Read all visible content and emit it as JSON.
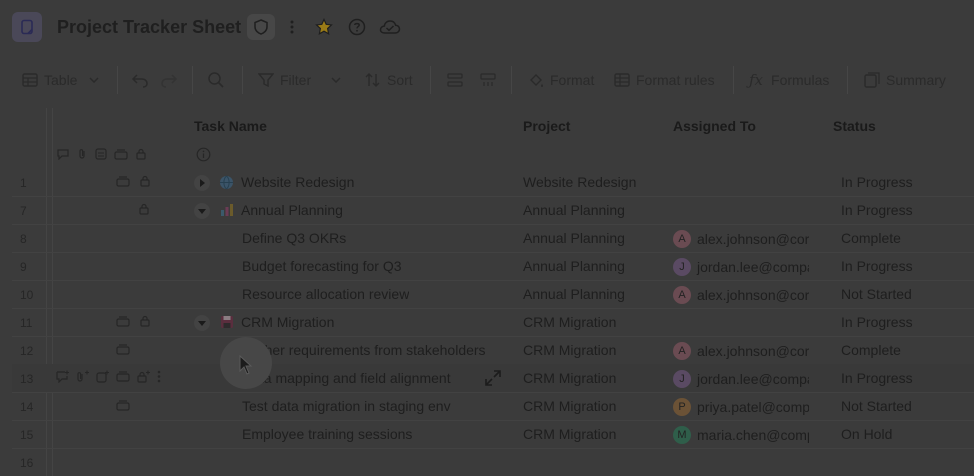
{
  "app": {
    "title": "Project Tracker Sheet",
    "icons": [
      "doc-icon",
      "shield-icon",
      "more-vertical-icon",
      "star-icon",
      "help-icon",
      "cloud-check-icon"
    ],
    "accent": "#c9a227"
  },
  "toolbar": {
    "view_label": "Table",
    "filter_label": "Filter",
    "sort_label": "Sort",
    "format_label": "Format",
    "format_rules_label": "Format rules",
    "formulas_label": "Formulas",
    "summary_label": "Summary"
  },
  "columns": {
    "task": "Task Name",
    "project": "Project",
    "assigned": "Assigned To",
    "status": "Status"
  },
  "rows": [
    {
      "num": "1",
      "task": "Website Redesign",
      "project": "Website Redesign",
      "assigned": "",
      "avatar": "",
      "status": "In Progress",
      "parent": true,
      "collapsed": true,
      "icon": "globe-icon"
    },
    {
      "num": "7",
      "task": "Annual Planning",
      "project": "Annual Planning",
      "assigned": "",
      "avatar": "",
      "status": "In Progress",
      "parent": true,
      "collapsed": false,
      "icon": "bar-chart-icon"
    },
    {
      "num": "8",
      "task": "Define Q3 OKRs",
      "project": "Annual Planning",
      "assigned": "alex.johnson@cor",
      "avatar": "A",
      "status": "Complete"
    },
    {
      "num": "9",
      "task": "Budget forecasting for Q3",
      "project": "Annual Planning",
      "assigned": "jordan.lee@compa",
      "avatar": "J",
      "status": "In Progress"
    },
    {
      "num": "10",
      "task": "Resource allocation review",
      "project": "Annual Planning",
      "assigned": "alex.johnson@cor",
      "avatar": "A",
      "status": "Not Started"
    },
    {
      "num": "11",
      "task": "CRM Migration",
      "project": "CRM Migration",
      "assigned": "",
      "avatar": "",
      "status": "In Progress",
      "parent": true,
      "collapsed": false,
      "icon": "floppy-icon"
    },
    {
      "num": "12",
      "task": "Gather requirements from stakeholders",
      "project": "CRM Migration",
      "assigned": "alex.johnson@cor",
      "avatar": "A",
      "status": "Complete"
    },
    {
      "num": "13",
      "task": "Data mapping and field alignment",
      "project": "CRM Migration",
      "assigned": "jordan.lee@compa",
      "avatar": "J",
      "status": "In Progress"
    },
    {
      "num": "14",
      "task": "Test data migration in staging env",
      "project": "CRM Migration",
      "assigned": "priya.patel@comp",
      "avatar": "P",
      "status": "Not Started"
    },
    {
      "num": "15",
      "task": "Employee training sessions",
      "project": "CRM Migration",
      "assigned": "maria.chen@comp",
      "avatar": "M",
      "status": "On Hold"
    },
    {
      "num": "16",
      "task": "",
      "project": "",
      "assigned": "",
      "avatar": "",
      "status": ""
    }
  ]
}
